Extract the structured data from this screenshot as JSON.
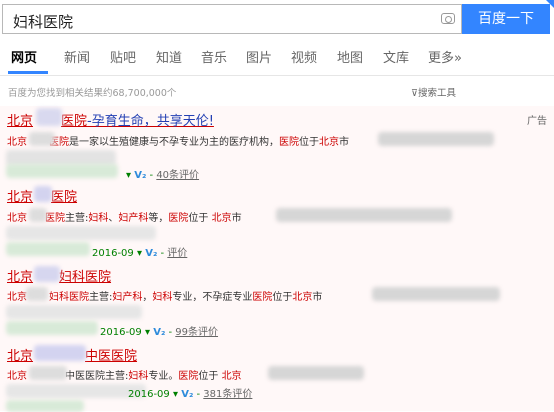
{
  "search": {
    "query": "妇科医院",
    "button_label": "百度一下"
  },
  "tabs": [
    {
      "label": "网页",
      "active": true
    },
    {
      "label": "新闻"
    },
    {
      "label": "贴吧"
    },
    {
      "label": "知道"
    },
    {
      "label": "音乐"
    },
    {
      "label": "图片"
    },
    {
      "label": "视频"
    },
    {
      "label": "地图"
    },
    {
      "label": "文库"
    },
    {
      "label": "更多»"
    }
  ],
  "result_count": "百度为您找到相关结果约68,700,000个",
  "search_tools": "搜索工具",
  "ad_label": "广告",
  "results": [
    {
      "title_red_a": "北京",
      "title_red_b": "医院",
      "title_blue": "-孕育生命，共享天伦!",
      "snippet": [
        "北京",
        "医院",
        "是一家以生殖健康与不孕专业为主的医疗机构，",
        "医院",
        "位于",
        "北京",
        "市"
      ],
      "meta_link": "40条评价"
    },
    {
      "title_red_a": "北京",
      "title_red_b": "医院",
      "snippet": [
        "北京",
        "医院",
        "主营:",
        "妇科",
        "、",
        "妇产科",
        "等，",
        "医院",
        "位于 ",
        "北京",
        "市"
      ],
      "meta_date": "2016-09",
      "meta_link": "评价"
    },
    {
      "title_red_a": "北京",
      "title_red_b": "妇科医院",
      "snippet": [
        "北京",
        "妇科医院",
        "主营:",
        "妇产科",
        "，",
        "妇科",
        "专业，不孕症专业",
        "医院",
        "位于",
        "北京",
        "市"
      ],
      "meta_date": "2016-09",
      "meta_link": "99条评价"
    },
    {
      "title_red_a": "北京",
      "title_red_b": "中医医院",
      "snippet": [
        "北京",
        "中医医院主营:",
        "妇科",
        "专业。",
        "医院",
        "位于 ",
        "北京"
      ],
      "meta_date": "2016-09",
      "meta_link": "381条评价"
    }
  ],
  "colors": {
    "accent": "#3385ff",
    "title_red": "#cc0000",
    "link_blue": "#2440b3",
    "url_green": "#008000"
  }
}
